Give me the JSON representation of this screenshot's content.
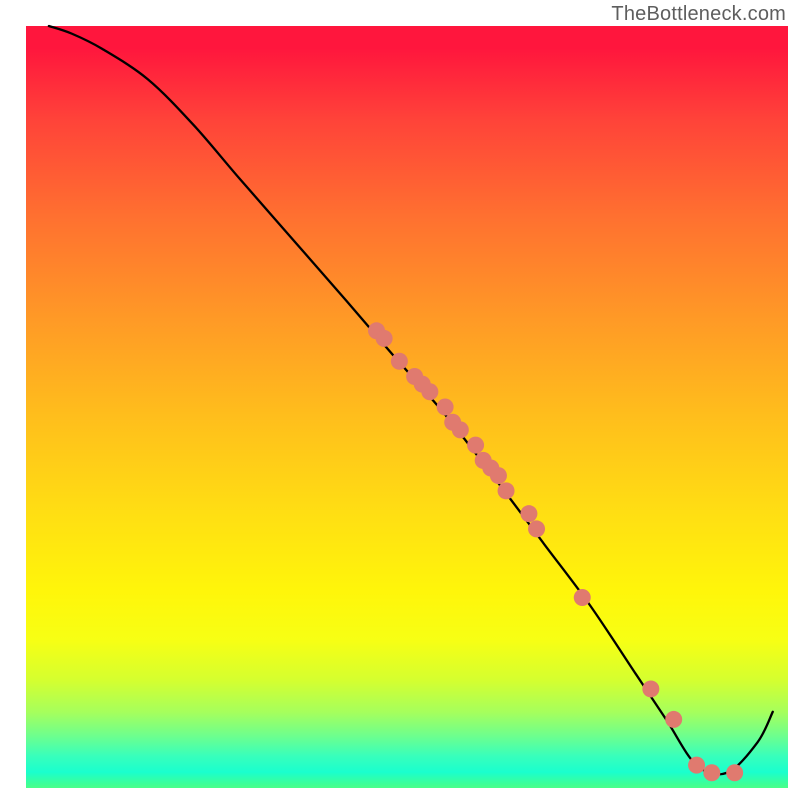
{
  "watermark": "TheBottleneck.com",
  "chart_data": {
    "type": "line",
    "title": "",
    "xlabel": "",
    "ylabel": "",
    "xlim": [
      0,
      100
    ],
    "ylim": [
      0,
      100
    ],
    "grid": false,
    "legend": false,
    "background": "vertical-gradient red→orange→yellow→green",
    "series": [
      {
        "name": "curve",
        "description": "smooth black curve starting near top-left, descending roughly linearly through the middle, bottoming out near x≈88 then rising again at the right edge",
        "x": [
          3,
          6,
          10,
          16,
          22,
          28,
          35,
          42,
          48,
          55,
          62,
          68,
          74,
          80,
          84,
          88,
          92,
          96,
          98
        ],
        "y": [
          100,
          99,
          97,
          93,
          87,
          80,
          72,
          64,
          57,
          49,
          40,
          32,
          24,
          15,
          9,
          3,
          2,
          6,
          10
        ]
      },
      {
        "name": "markers",
        "description": "salmon-colored scatter points lying on the curve, clustered mid-diagonal and along the trough",
        "x": [
          46,
          47,
          49,
          51,
          52,
          53,
          55,
          56,
          57,
          59,
          60,
          61,
          62,
          63,
          66,
          67,
          73,
          82,
          85,
          88,
          90,
          93
        ],
        "y": [
          60,
          59,
          56,
          54,
          53,
          52,
          50,
          48,
          47,
          45,
          43,
          42,
          41,
          39,
          36,
          34,
          25,
          13,
          9,
          3,
          2,
          2
        ]
      }
    ]
  },
  "colors": {
    "curve": "#000000",
    "marker": "#e07a6f"
  }
}
